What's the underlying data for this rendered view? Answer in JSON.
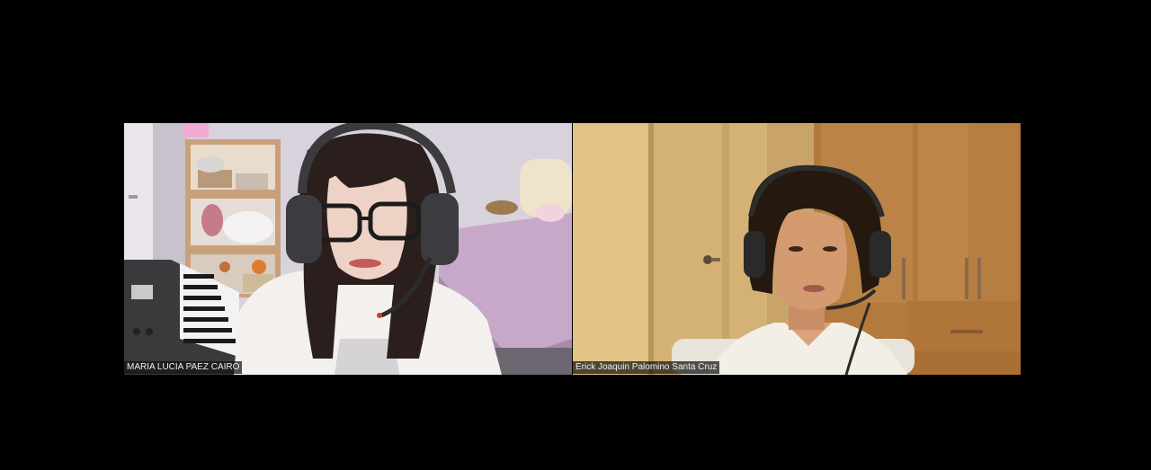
{
  "meeting": {
    "participants": [
      {
        "name": "MARIA LUCIA PAEZ CAIRO",
        "video_on": true
      },
      {
        "name": "Erick Joaquin Palomino Santa Cruz",
        "video_on": true
      }
    ]
  },
  "colors": {
    "background": "#000000",
    "name_tag_bg": "#141414",
    "name_tag_text": "#f0f0f0"
  }
}
